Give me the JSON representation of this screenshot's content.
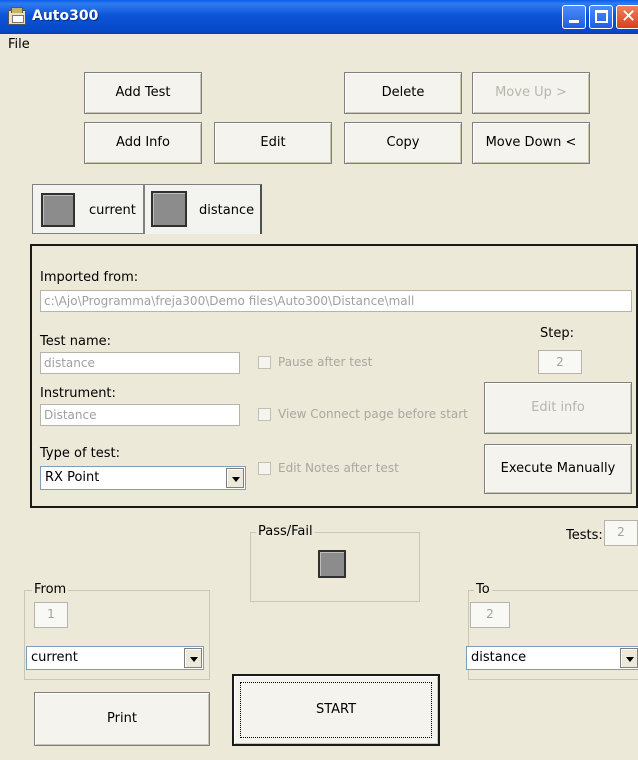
{
  "window": {
    "title": "Auto300"
  },
  "menu": {
    "file": "File"
  },
  "toolbar": {
    "add_test": "Add Test",
    "delete": "Delete",
    "move_up": "Move Up >",
    "add_info": "Add Info",
    "edit": "Edit",
    "copy": "Copy",
    "move_down": "Move Down <"
  },
  "tabs": [
    {
      "label": "current"
    },
    {
      "label": "distance"
    }
  ],
  "details": {
    "imported_from_label": "Imported from:",
    "imported_from_value": "c:\\Ajo\\Programma\\freja300\\Demo files\\Auto300\\Distance\\mall",
    "test_name_label": "Test name:",
    "test_name_value": "distance",
    "instrument_label": "Instrument:",
    "instrument_value": "Distance",
    "type_label": "Type of test:",
    "type_value": "RX Point",
    "pause_after_test": "Pause after test",
    "view_connect": "View Connect page before start",
    "edit_notes": "Edit Notes after test",
    "step_label": "Step:",
    "step_value": "2",
    "edit_info": "Edit info",
    "execute_manually": "Execute Manually"
  },
  "run": {
    "pass_fail_label": "Pass/Fail",
    "tests_label": "Tests:",
    "tests_value": "2",
    "from_label": "From",
    "from_value": "1",
    "from_select": "current",
    "to_label": "To",
    "to_value": "2",
    "to_select": "distance",
    "print": "Print",
    "start": "START"
  }
}
